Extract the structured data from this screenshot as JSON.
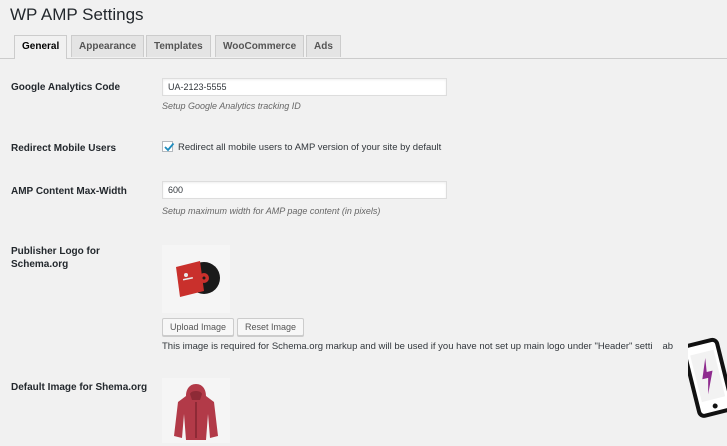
{
  "page": {
    "title": "WP AMP Settings"
  },
  "tabs": [
    {
      "label": "General",
      "active": true
    },
    {
      "label": "Appearance",
      "active": false
    },
    {
      "label": "Templates",
      "active": false
    },
    {
      "label": "WooCommerce",
      "active": false
    },
    {
      "label": "Ads",
      "active": false
    }
  ],
  "analytics": {
    "label": "Google Analytics Code",
    "value": "UA-2123-5555",
    "description": "Setup Google Analytics tracking ID"
  },
  "redirect": {
    "label": "Redirect Mobile Users",
    "checked": true,
    "checkbox_label": "Redirect all mobile users to AMP version of your site by default"
  },
  "max_width": {
    "label": "AMP Content Max-Width",
    "value": "600",
    "description": "Setup maximum width for AMP page content (in pixels)"
  },
  "publisher_logo": {
    "label_line1": "Publisher Logo for",
    "label_line2": "Schema.org",
    "upload_label": "Upload Image",
    "reset_label": "Reset Image",
    "note": "This image is required for Schema.org markup and will be used if you have not set up main logo under \"Header\" setti",
    "note_tail": "ab"
  },
  "default_image": {
    "label": "Default Image for Shema.org"
  },
  "colors": {
    "accent": "#0073aa",
    "background": "#f1f1f1",
    "logo_red": "#c9302c",
    "hoodie_red": "#b23a48",
    "phone_purple": "#8e2b8e"
  },
  "icons": {
    "checkbox": "checkmark-icon",
    "phone": "amp-phone-icon"
  }
}
